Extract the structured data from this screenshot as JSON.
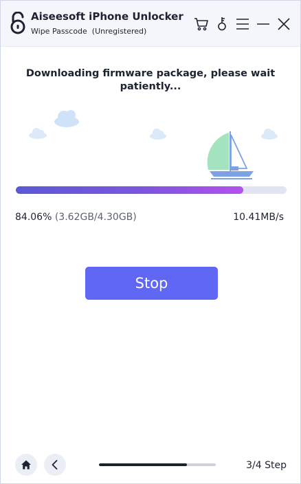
{
  "app": {
    "title": "Aiseesoft iPhone Unlocker",
    "subtitle": "Wipe Passcode  (Unregistered)",
    "icons": [
      "cart-icon",
      "key-icon",
      "menu-icon",
      "minimize-icon",
      "close-icon"
    ]
  },
  "download": {
    "heading": "Downloading firmware package, please wait patiently...",
    "percent": "84.06%",
    "size_detail": "(3.62GB/4.30GB)",
    "speed": "10.41MB/s",
    "progress_fraction": 0.8406
  },
  "actions": {
    "stop_label": "Stop"
  },
  "footer": {
    "step_label": "3/4 Step",
    "step_progress_fraction": 0.75,
    "home_icon": "home-icon",
    "back_icon": "chevron-left-icon"
  },
  "colors": {
    "accent": "#6167f5",
    "progress_start": "#5b59d6",
    "progress_end": "#b451ee",
    "sail": "#a3e3bd",
    "boat": "#7ea1e3",
    "cloud": "#cfe2f7"
  }
}
